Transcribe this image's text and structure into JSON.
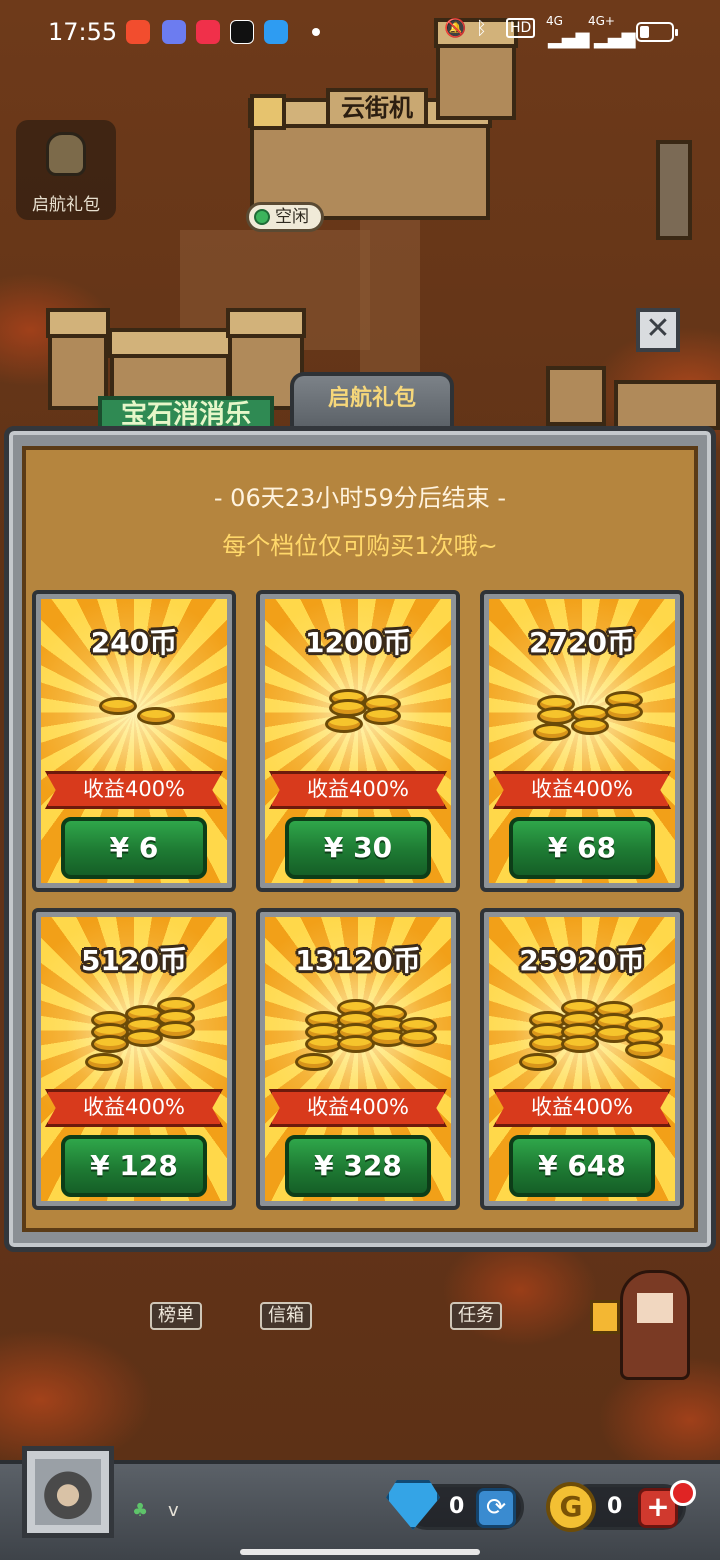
{
  "status_bar": {
    "time": "17:55",
    "network_1": "4G",
    "network_2": "4G+",
    "hd_label": "HD",
    "battery_level": 0.3
  },
  "map": {
    "sign_arcade": "云街机",
    "sign_gem_shop": "宝石消消乐",
    "status_idle": "空闲",
    "labels": [
      "榜单",
      "信箱",
      "任务"
    ]
  },
  "gift_button": {
    "label": "启航礼包",
    "icon": "bag-icon"
  },
  "panel": {
    "tab_title": "启航礼包",
    "countdown": "- 06天23小时59分后结束 -",
    "limit_note": "每个档位仅可购买1次哦~",
    "close_icon": "close-icon"
  },
  "packs": [
    {
      "coins": "240币",
      "bonus": "收益400%",
      "price": "¥ 6"
    },
    {
      "coins": "1200币",
      "bonus": "收益400%",
      "price": "¥ 30"
    },
    {
      "coins": "2720币",
      "bonus": "收益400%",
      "price": "¥ 68"
    },
    {
      "coins": "5120币",
      "bonus": "收益400%",
      "price": "¥ 128"
    },
    {
      "coins": "13120币",
      "bonus": "收益400%",
      "price": "¥ 328"
    },
    {
      "coins": "25920币",
      "bonus": "收益400%",
      "price": "¥ 648"
    }
  ],
  "bottom_bar": {
    "level": "v",
    "gems": "0",
    "gold": "0",
    "gold_symbol": "G"
  },
  "colors": {
    "accent_gold": "#ffd86a",
    "price_green": "#1e7a33",
    "ribbon_red": "#d83a1c"
  }
}
